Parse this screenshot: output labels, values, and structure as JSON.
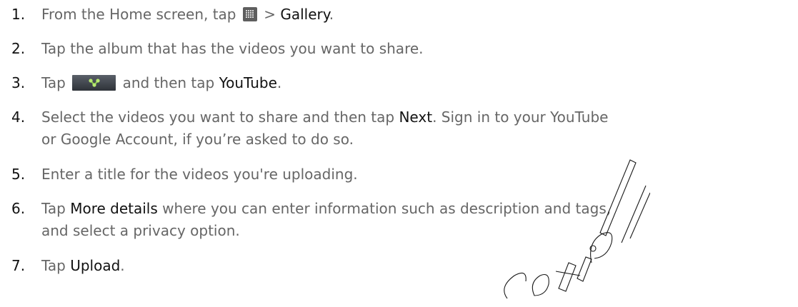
{
  "steps": [
    {
      "num": "1.",
      "pre": "From the Home screen, tap ",
      "icon": "all-apps-grid-icon",
      "mid": " > ",
      "hl": "Gallery",
      "post": "."
    },
    {
      "num": "2.",
      "text": "Tap the album that has the videos you want to share."
    },
    {
      "num": "3.",
      "pre": "Tap ",
      "icon": "share-icon",
      "mid": " and then tap ",
      "hl": "YouTube",
      "post": "."
    },
    {
      "num": "4.",
      "pre": "Select the videos you want to share and then tap ",
      "hl": "Next",
      "post": ". Sign in to your YouTube",
      "line2": "or Google Account, if you’re asked to do so."
    },
    {
      "num": "5.",
      "text": "Enter a title for the videos you're uploading."
    },
    {
      "num": "6.",
      "pre": "Tap ",
      "hl": "More details",
      "post": " where you can enter information such as description and tags,",
      "line2": "and select a privacy option."
    },
    {
      "num": "7.",
      "pre": "Tap ",
      "hl": "Upload",
      "post": "."
    }
  ],
  "watermark": {
    "text": "Confidential",
    "icon": "confidential-watermark",
    "color": "#111111"
  }
}
